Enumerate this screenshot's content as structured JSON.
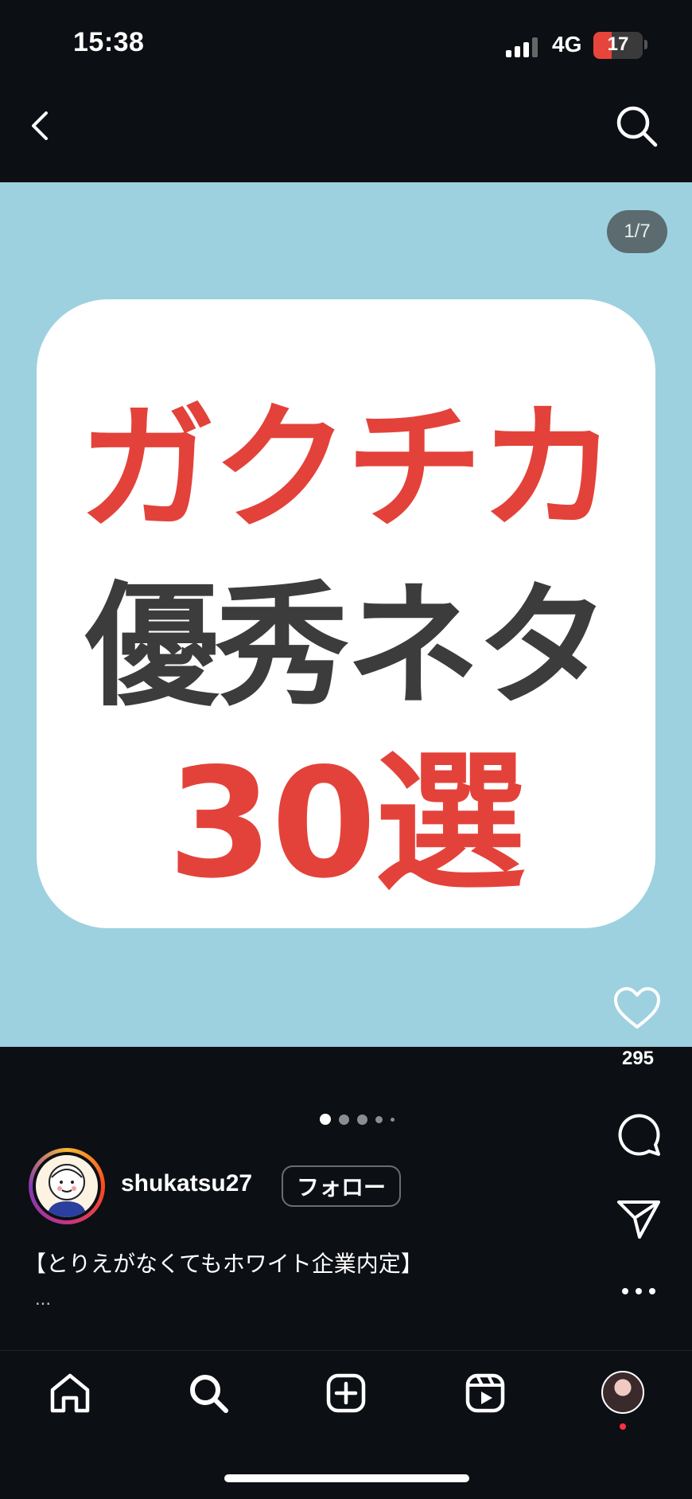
{
  "status_bar": {
    "time": "15:38",
    "network": "4G",
    "battery": "17",
    "battery_level": 0.17
  },
  "nav": {
    "back_icon": "chevron-left-icon",
    "search_icon": "search-icon"
  },
  "post": {
    "image_counter": "1/7",
    "image_text": {
      "line1": "ガクチカ",
      "line2": "優秀ネタ",
      "line3": "30選"
    },
    "colors": {
      "background": "#9dd1df",
      "accent": "#e3423a",
      "dark": "#3c3c3c"
    },
    "pagination": {
      "total_visible": 5,
      "active_index": 0
    }
  },
  "actions": {
    "like_count": "295"
  },
  "account": {
    "username": "shukatsu27",
    "follow_label": "フォロー"
  },
  "caption": {
    "text": "【とりえがなくてもホワイト企業内定】",
    "more": "..."
  },
  "tabbar": {
    "items": [
      "home-icon",
      "search-icon",
      "create-icon",
      "reels-icon",
      "profile-avatar"
    ]
  }
}
